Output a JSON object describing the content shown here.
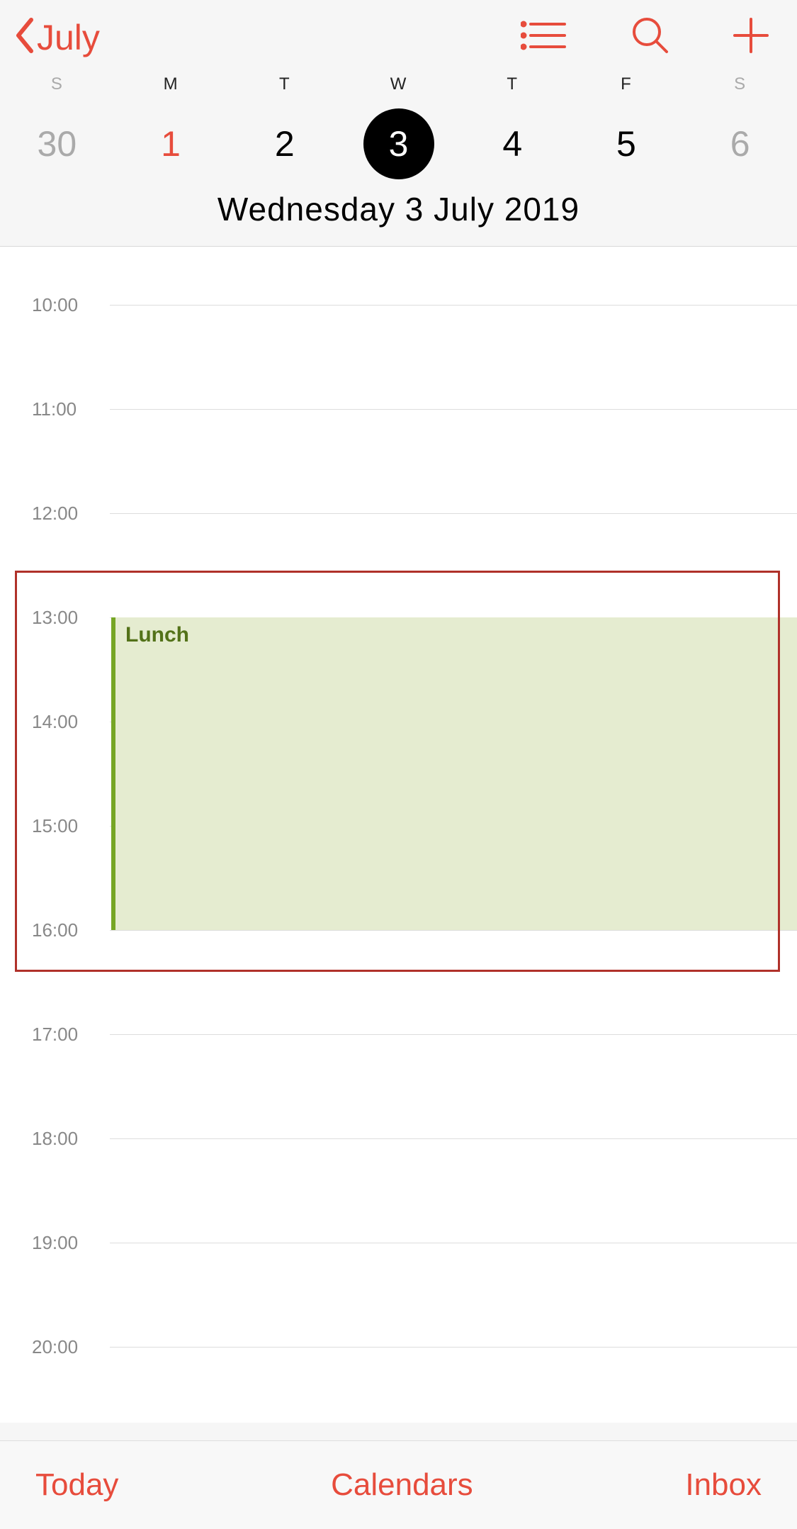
{
  "header": {
    "back_label": "July"
  },
  "week": {
    "days": [
      {
        "abbrev": "S",
        "number": "30",
        "weekend": true
      },
      {
        "abbrev": "M",
        "number": "1",
        "red": true
      },
      {
        "abbrev": "T",
        "number": "2"
      },
      {
        "abbrev": "W",
        "number": "3",
        "selected": true
      },
      {
        "abbrev": "T",
        "number": "4"
      },
      {
        "abbrev": "F",
        "number": "5"
      },
      {
        "abbrev": "S",
        "number": "6",
        "weekend": true
      }
    ]
  },
  "full_date": "Wednesday  3 July 2019",
  "hours": [
    "10:00",
    "11:00",
    "12:00",
    "13:00",
    "14:00",
    "15:00",
    "16:00",
    "17:00",
    "18:00",
    "19:00",
    "20:00"
  ],
  "event": {
    "title": "Lunch",
    "start_hour_index": 3,
    "end_hour_index": 6
  },
  "highlight": {
    "top_offset_hours": 2.55,
    "height_hours": 3.85
  },
  "bottom": {
    "today": "Today",
    "calendars": "Calendars",
    "inbox": "Inbox"
  }
}
